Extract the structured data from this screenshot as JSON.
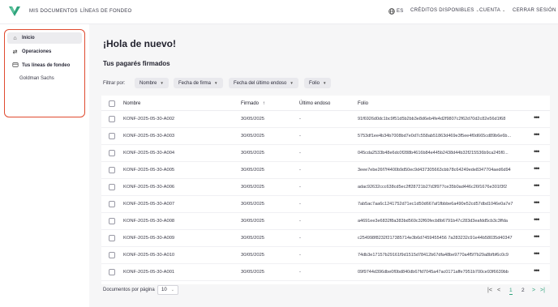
{
  "header": {
    "nav_left": [
      "MIS DOCUMENTOS",
      "LÍNEAS DE FONDEO"
    ],
    "language": "ES",
    "credits": "CRÉDITOS DISPONIBLES",
    "account": "CUENTA",
    "logout": "CERRAR SESIÓN",
    "brand_color": "#2fa37c"
  },
  "sidebar": {
    "items": [
      {
        "label": "Inicio",
        "icon": "home-icon"
      },
      {
        "label": "Operaciones",
        "icon": "swap-icon"
      },
      {
        "label": "Tus líneas de fondeo",
        "icon": "funding-lines-icon"
      }
    ],
    "sub_items": [
      "Goldman Sachs"
    ],
    "highlight_color": "#e04a2f"
  },
  "main": {
    "greeting": "¡Hola de nuevo!",
    "section_title": "Tus pagarés firmados",
    "filter_label": "Filtrar por:",
    "filters": [
      "Nombre",
      "Fecha de firma",
      "Fecha del último endoso",
      "Folio"
    ],
    "table": {
      "columns": [
        "Nombre",
        "Firmado",
        "Último endoso",
        "Folio"
      ],
      "sort_indicator": "↑",
      "rows": [
        {
          "name": "KONF-2025-05-30-A002",
          "signed": "30/05/2025",
          "last": "-",
          "folio": "91f6926d0dc1bc9f51d5b2bb3e8d6eb4fe4d2f9807c2f62d70d2c82e56d1f68"
        },
        {
          "name": "KONF-2025-05-30-A003",
          "signed": "30/05/2025",
          "last": "-",
          "folio": "5753df1ee4b34b7008bd7e0d7c558ab51863d469e3f5ee4f0d665cd89b6e6b..."
        },
        {
          "name": "KONF-2025-05-30-A004",
          "signed": "30/05/2025",
          "last": "-",
          "folio": "045cda2533b48e6dc0f288b4616b84e445b2438d44b32f215536b9ca245f0..."
        },
        {
          "name": "KONF-2025-05-30-A005",
          "signed": "30/05/2025",
          "last": "-",
          "folio": "3eee7ebe26f7f4400b9d50ec9d437305663cbb78c64249ede8347704aed6d94"
        },
        {
          "name": "KONF-2025-05-30-A006",
          "signed": "30/05/2025",
          "last": "-",
          "folio": "adac92632ccc638cd5ec2ff28721b27d3f977ce35b0ad446c26f1676e301f3f2"
        },
        {
          "name": "KONF-2025-05-30-A007",
          "signed": "30/05/2025",
          "last": "-",
          "folio": "7ab5ac7aa6c1241752d71ec1d50d667af1fbbbe6a490e52cd57dbd1046e0a7e7"
        },
        {
          "name": "KONF-2025-05-30-A008",
          "signed": "30/05/2025",
          "last": "-",
          "folio": "a4691ee3e6832f8a383bd569c32f60fecb8b6791b47c283d3eafdd5cb3c3ffda"
        },
        {
          "name": "KONF-2025-05-30-A009",
          "signed": "30/05/2025",
          "last": "-",
          "folio": "c254998f8232f217385714e3b6d7459455456 7a283232c91e44b58035d40347"
        },
        {
          "name": "KONF-2025-05-30-A010",
          "signed": "30/05/2025",
          "last": "-",
          "folio": "74db3e17157b29161f9d1515d78412b67dfa48be9770a4f5f7b29a8bfbf6c0c9"
        },
        {
          "name": "KONF-2025-05-30-A001",
          "signed": "30/05/2025",
          "last": "-",
          "folio": "09f9744d396dbe0f0bd840db67fd7045a47ac0171affe7951b700ce93f6639bb"
        }
      ]
    },
    "pagination": {
      "label": "Documentos por página",
      "page_size": "10",
      "pages": [
        "1",
        "2"
      ],
      "current_page": "1"
    }
  }
}
